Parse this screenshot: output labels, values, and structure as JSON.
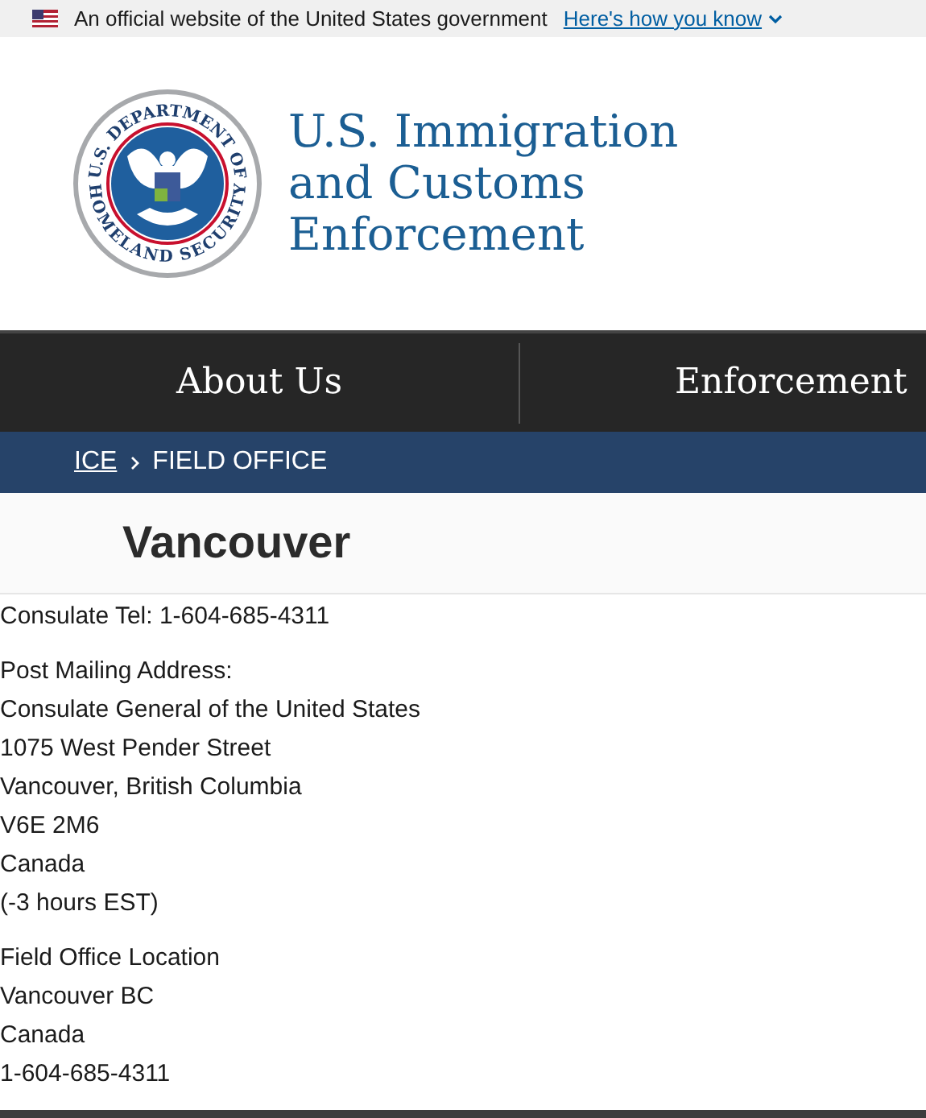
{
  "gov_banner": {
    "text": "An official website of the United States government",
    "link": "Here's how you know"
  },
  "header": {
    "seal_top": "U.S. DEPARTMENT OF",
    "seal_bottom": "HOMELAND SECURITY",
    "agency_lines": [
      "U.S. Immigration",
      "and Customs",
      "Enforcement"
    ]
  },
  "nav": {
    "items": [
      "About Us",
      "Enforcement"
    ]
  },
  "breadcrumb": {
    "items": [
      {
        "label": "ICE",
        "link": true
      },
      {
        "label": "FIELD OFFICE",
        "link": false
      }
    ]
  },
  "page_title": "Vancouver",
  "content": [
    [
      "Consulate Tel: 1-604-685-4311"
    ],
    [
      "Post Mailing Address:",
      "Consulate General of the United States",
      "1075 West Pender Street",
      "Vancouver, British Columbia",
      "V6E 2M6",
      "Canada",
      "(-3 hours EST)"
    ],
    [
      "Field Office Location",
      "Vancouver BC",
      "Canada",
      "1-604-685-4311"
    ]
  ]
}
